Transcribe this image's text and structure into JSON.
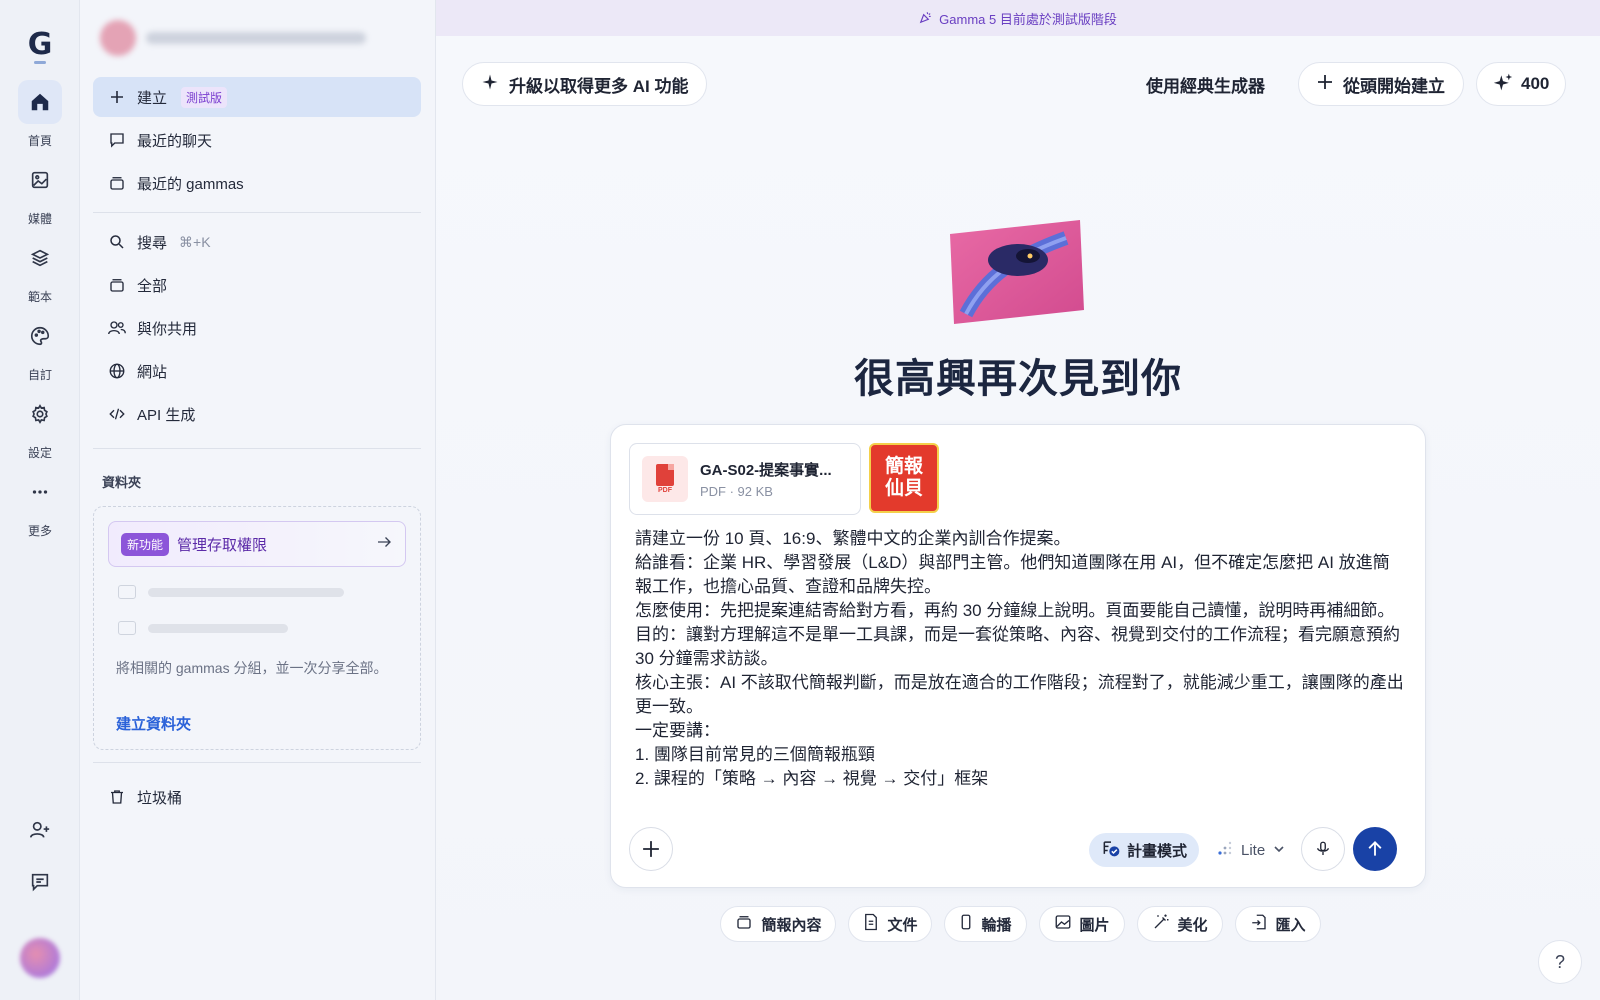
{
  "rail": {
    "logo": "G",
    "items": [
      {
        "label": "首頁",
        "icon": "home-icon"
      },
      {
        "label": "媒體",
        "icon": "image-icon"
      },
      {
        "label": "範本",
        "icon": "layers-icon"
      },
      {
        "label": "自訂",
        "icon": "palette-icon"
      },
      {
        "label": "設定",
        "icon": "gear-icon"
      },
      {
        "label": "更多",
        "icon": "more-icon"
      }
    ],
    "bottom_icons": [
      "add-user-icon",
      "feedback-icon"
    ]
  },
  "sidebar": {
    "create": {
      "label": "建立",
      "badge": "測試版"
    },
    "recent_chats": "最近的聊天",
    "recent_gammas": "最近的 gammas",
    "search": {
      "label": "搜尋",
      "shortcut": "⌘+K"
    },
    "all": "全部",
    "shared": "與你共用",
    "sites": "網站",
    "api": "API 生成",
    "folders": {
      "title": "資料夾",
      "new_feature_tag": "新功能",
      "manage_access": "管理存取權限",
      "description": "將相關的 gammas 分組，並一次分享全部。",
      "create_folder": "建立資料夾"
    },
    "trash": "垃圾桶"
  },
  "banner": {
    "text": "Gamma 5 目前處於測試版階段"
  },
  "header": {
    "upgrade": "升級以取得更多 AI 功能",
    "classic_generator": "使用經典生成器",
    "start_from_scratch": "從頭開始建立",
    "credits": "400"
  },
  "hero": {
    "title": "很高興再次見到你"
  },
  "composer": {
    "attachment": {
      "name": "GA-S02-提案事實...",
      "meta": "PDF · 92 KB"
    },
    "thumbnail_text": "簡報\n仙貝",
    "prompt_lines": [
      "請建立一份 10 頁、16:9、繁體中文的企業內訓合作提案。",
      "給誰看：企業 HR、學習發展（L&D）與部門主管。他們知道團隊在用 AI，但不確定怎麼把 AI 放進簡報工作，也擔心品質、查證和品牌失控。",
      "怎麼使用：先把提案連結寄給對方看，再約 30 分鐘線上說明。頁面要能自己讀懂，說明時再補細節。",
      "目的：讓對方理解這不是單一工具課，而是一套從策略、內容、視覺到交付的工作流程；看完願意預約 30 分鐘需求訪談。",
      "核心主張：AI 不該取代簡報判斷，而是放在適合的工作階段；流程對了，就能減少重工，讓團隊的產出更一致。",
      "一定要講：",
      "1. 團隊目前常見的三個簡報瓶頸",
      "2. 課程的「策略 → 內容 → 視覺 → 交付」框架"
    ],
    "plan_mode": "計畫模式",
    "model": "Lite"
  },
  "chips": [
    {
      "label": "簡報內容",
      "icon": "presentation-icon"
    },
    {
      "label": "文件",
      "icon": "document-icon"
    },
    {
      "label": "輪播",
      "icon": "carousel-icon"
    },
    {
      "label": "圖片",
      "icon": "image-icon"
    },
    {
      "label": "美化",
      "icon": "magic-wand-icon"
    },
    {
      "label": "匯入",
      "icon": "import-icon"
    }
  ],
  "help": "?",
  "colors": {
    "accent": "#1942a6",
    "beta": "#7b3fd0",
    "link": "#2b62d9"
  }
}
